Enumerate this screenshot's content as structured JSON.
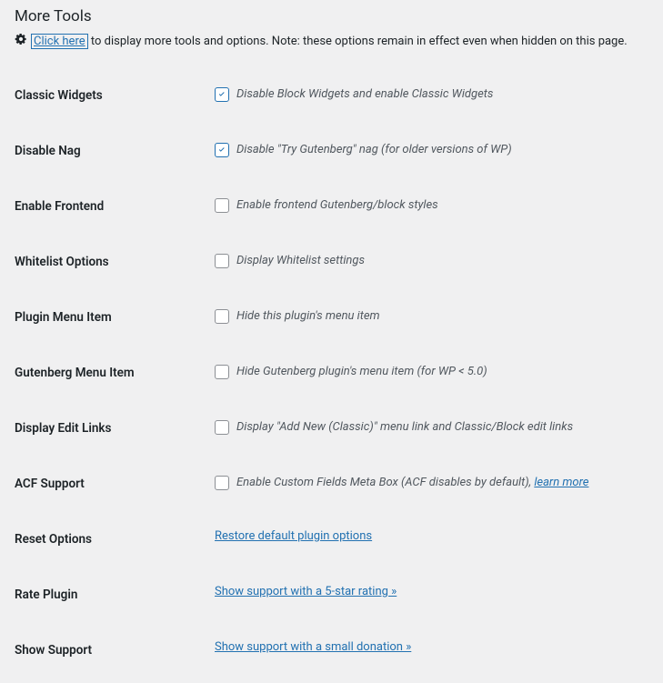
{
  "section_title": "More Tools",
  "intro": {
    "link_text": "Click here",
    "rest": " to display more tools and options. Note: these options remain in effect even when hidden on this page."
  },
  "options": {
    "classic_widgets": {
      "label": "Classic Widgets",
      "desc": "Disable Block Widgets and enable Classic Widgets"
    },
    "disable_nag": {
      "label": "Disable Nag",
      "desc": "Disable \"Try Gutenberg\" nag (for older versions of WP)"
    },
    "enable_frontend": {
      "label": "Enable Frontend",
      "desc": "Enable frontend Gutenberg/block styles"
    },
    "whitelist_options": {
      "label": "Whitelist Options",
      "desc": "Display Whitelist settings"
    },
    "plugin_menu_item": {
      "label": "Plugin Menu Item",
      "desc": "Hide this plugin's menu item"
    },
    "gutenberg_menu_item": {
      "label": "Gutenberg Menu Item",
      "desc": "Hide Gutenberg plugin's menu item (for WP < 5.0)"
    },
    "display_edit_links": {
      "label": "Display Edit Links",
      "desc": "Display \"Add New (Classic)\" menu link and Classic/Block edit links"
    },
    "acf_support": {
      "label": "ACF Support",
      "desc_prefix": "Enable Custom Fields Meta Box (ACF disables by default), ",
      "learn_more": "learn more"
    },
    "reset_options": {
      "label": "Reset Options",
      "link": "Restore default plugin options"
    },
    "rate_plugin": {
      "label": "Rate Plugin",
      "link": "Show support with a 5-star rating »"
    },
    "show_support": {
      "label": "Show Support",
      "link": "Show support with a small donation »"
    }
  }
}
